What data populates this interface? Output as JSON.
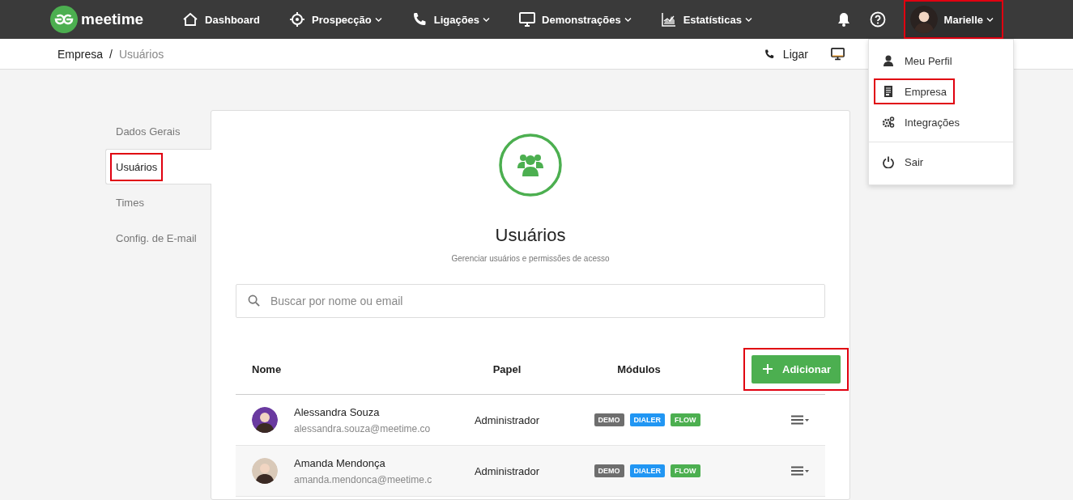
{
  "navbar": {
    "logo": "meetime",
    "items": [
      {
        "label": "Dashboard",
        "dropdown": false
      },
      {
        "label": "Prospecção",
        "dropdown": true
      },
      {
        "label": "Ligações",
        "dropdown": true
      },
      {
        "label": "Demonstrações",
        "dropdown": true
      },
      {
        "label": "Estatísticas",
        "dropdown": true
      }
    ],
    "user": {
      "name": "Marielle",
      "highlighted": true
    }
  },
  "breadcrumb": {
    "separator": "/",
    "items": [
      {
        "label": "Empresa",
        "selected": false
      },
      {
        "label": "Usuários",
        "selected": true
      }
    ]
  },
  "quick_actions": [
    {
      "label": "Ligar"
    }
  ],
  "user_menu": [
    {
      "kind": "item",
      "label": "Meu Perfil",
      "highlighted": false
    },
    {
      "kind": "item",
      "label": "Empresa",
      "highlighted": true
    },
    {
      "kind": "item",
      "label": "Integrações",
      "highlighted": false
    },
    {
      "kind": "divider"
    },
    {
      "kind": "item",
      "label": "Sair",
      "highlighted": false
    }
  ],
  "sidebar": {
    "items": [
      {
        "label": "Dados Gerais",
        "selected": false,
        "highlighted": false
      },
      {
        "label": "Usuários",
        "selected": true,
        "highlighted": true
      },
      {
        "label": "Times",
        "selected": false,
        "highlighted": false
      },
      {
        "label": "Config. de E-mail",
        "selected": false,
        "highlighted": false
      }
    ]
  },
  "page": {
    "title": "Usuários",
    "subtitle": "Gerenciar usuários e permissões de acesso"
  },
  "search": {
    "placeholder": "Buscar por nome ou email"
  },
  "table": {
    "columns": [
      "Nome",
      "Papel",
      "Módulos"
    ],
    "add_button": {
      "label": "Adicionar",
      "highlighted": true
    },
    "rows": [
      {
        "name": "Alessandra Souza",
        "email": "alessandra.souza@meetime.co",
        "role": "Administrador",
        "modules": [
          {
            "label": "DEMO",
            "color": "#6e6e6e"
          },
          {
            "label": "DIALER",
            "color": "#2196f3"
          },
          {
            "label": "FLOW",
            "color": "#4caf50"
          }
        ]
      },
      {
        "name": "Amanda Mendonça",
        "email": "amanda.mendonca@meetime.c",
        "role": "Administrador",
        "modules": [
          {
            "label": "DEMO",
            "color": "#6e6e6e"
          },
          {
            "label": "DIALER",
            "color": "#2196f3"
          },
          {
            "label": "FLOW",
            "color": "#4caf50"
          }
        ]
      }
    ]
  }
}
